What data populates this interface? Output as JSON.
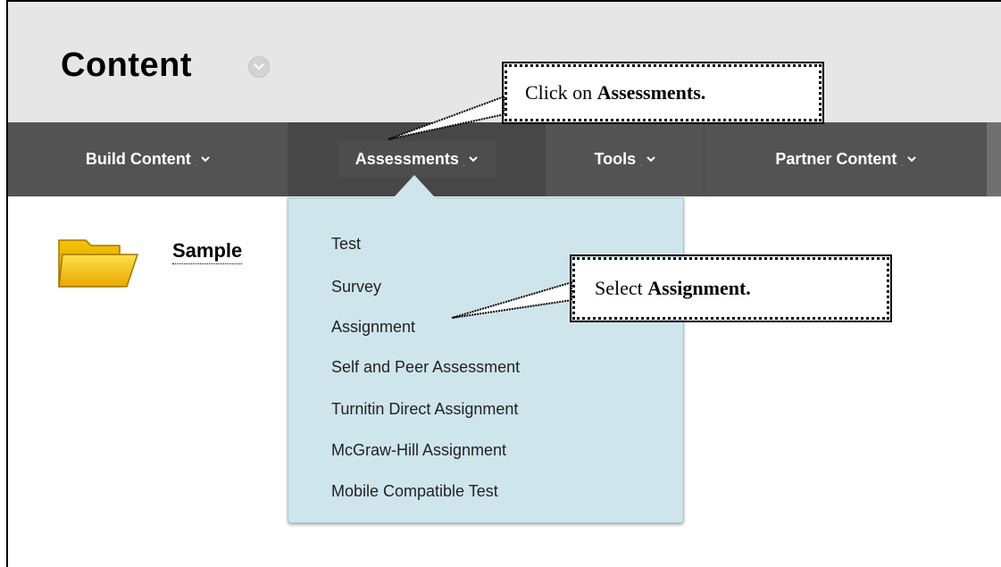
{
  "header": {
    "title": "Content"
  },
  "toolbar": {
    "items": [
      {
        "label": "Build Content"
      },
      {
        "label": "Assessments"
      },
      {
        "label": "Tools"
      },
      {
        "label": "Partner Content"
      }
    ]
  },
  "content": {
    "item_title": "Sample"
  },
  "menu": {
    "items": [
      {
        "label": "Test"
      },
      {
        "label": "Survey"
      },
      {
        "label": "Assignment"
      },
      {
        "label": "Self and Peer Assessment"
      },
      {
        "label": "Turnitin Direct Assignment"
      },
      {
        "label": "McGraw-Hill Assignment"
      },
      {
        "label": "Mobile Compatible Test"
      }
    ]
  },
  "callouts": {
    "assessments": {
      "prefix": "Click on ",
      "bold": "Assessments."
    },
    "assignment": {
      "prefix": "Select ",
      "bold": "Assignment."
    }
  },
  "colors": {
    "toolbar_bg": "#535353",
    "header_bg": "#e6e6e6",
    "menu_bg": "#cfe5ec"
  }
}
